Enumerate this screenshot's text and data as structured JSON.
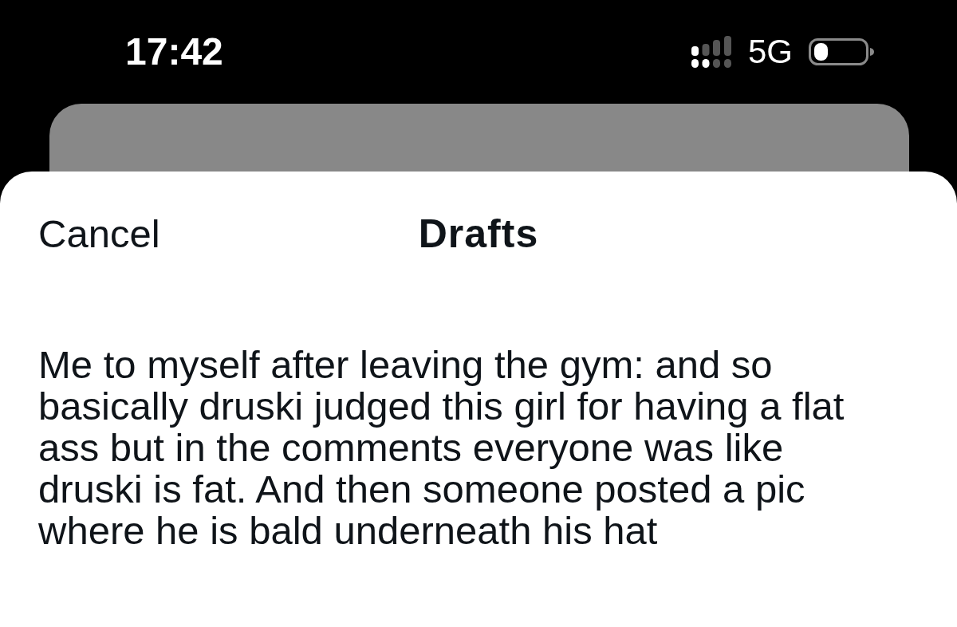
{
  "status_bar": {
    "time": "17:42",
    "network": "5G"
  },
  "sheet": {
    "cancel": "Cancel",
    "title": "Drafts"
  },
  "drafts": [
    {
      "text": "Me to myself after leaving the gym: and so\nbasically druski judged this girl for having a flat\nass but in the comments everyone was like\ndruski is fat. And then someone posted a pic\nwhere he is bald underneath his hat"
    }
  ]
}
